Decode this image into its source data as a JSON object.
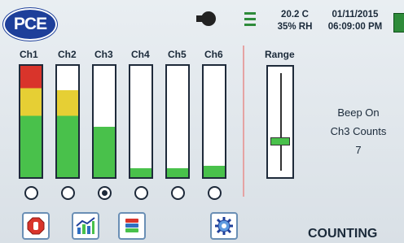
{
  "header": {
    "logo_text": "PCE",
    "temperature": "20.2 C",
    "humidity": "35% RH",
    "date": "01/11/2015",
    "time": "06:09:00 PM"
  },
  "channels": [
    {
      "label": "Ch1",
      "selected": false,
      "level": 1.0
    },
    {
      "label": "Ch2",
      "selected": false,
      "level": 0.78
    },
    {
      "label": "Ch3",
      "selected": true,
      "level": 0.45
    },
    {
      "label": "Ch4",
      "selected": false,
      "level": 0.08
    },
    {
      "label": "Ch5",
      "selected": false,
      "level": 0.08
    },
    {
      "label": "Ch6",
      "selected": false,
      "level": 0.1
    }
  ],
  "range": {
    "label": "Range",
    "level": 0.3
  },
  "status": {
    "beep": "Beep On",
    "counts_label": "Ch3 Counts",
    "count": "7"
  },
  "footer": {
    "mode": "COUNTING"
  },
  "colors": {
    "green": "#49c14b",
    "yellow": "#e6cf34",
    "red": "#d9342b",
    "brand": "#1e3f9a"
  }
}
